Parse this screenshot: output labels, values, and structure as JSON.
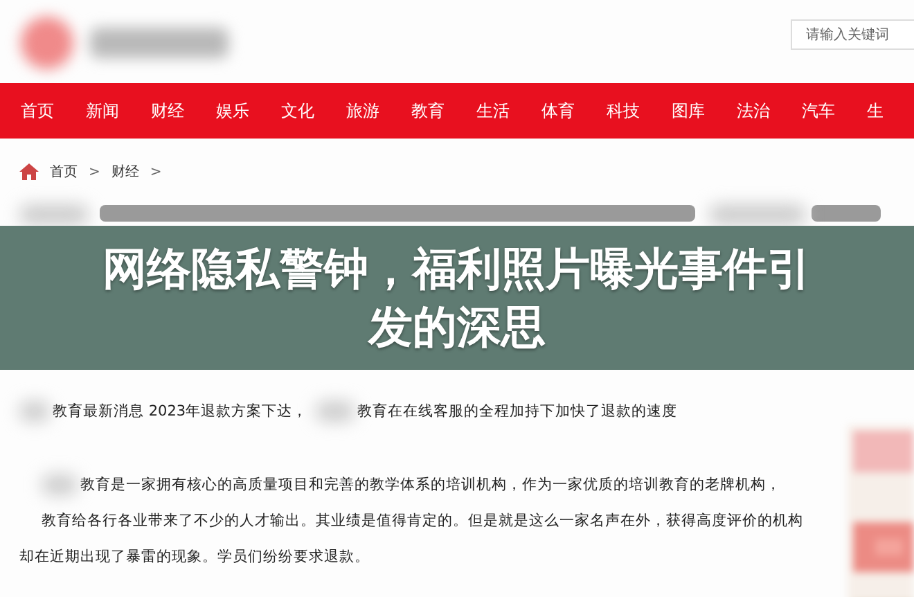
{
  "header": {
    "search": {
      "placeholder": "请输入关键词"
    }
  },
  "nav": {
    "items": [
      {
        "label": "首页"
      },
      {
        "label": "新闻"
      },
      {
        "label": "财经"
      },
      {
        "label": "娱乐"
      },
      {
        "label": "文化"
      },
      {
        "label": "旅游"
      },
      {
        "label": "教育"
      },
      {
        "label": "生活"
      },
      {
        "label": "体育"
      },
      {
        "label": "科技"
      },
      {
        "label": "图库"
      },
      {
        "label": "法治"
      },
      {
        "label": "汽车"
      },
      {
        "label": "生"
      }
    ]
  },
  "breadcrumb": {
    "items": [
      "首页",
      "财经"
    ],
    "separator": ">"
  },
  "banner": {
    "title": "网络隐私警钟，福利照片曝光事件引发的深思"
  },
  "article": {
    "lead": [
      "教育最新消息 2023年退款方案下达，",
      "教育在在线客服的全程加持下加快了退款的速度"
    ],
    "lines": [
      "教育是一家拥有核心的高质量项目和完善的教学体系的培训机构，作为一家优质的培训教育的老牌机构，",
      "教育给各行各业带来了不少的人才输出。其业绩是值得肯定的。但是就是这么一家名声在外，获得高度评价的机构",
      "却在近期出现了暴雷的现象。学员们纷纷要求退款。"
    ]
  }
}
